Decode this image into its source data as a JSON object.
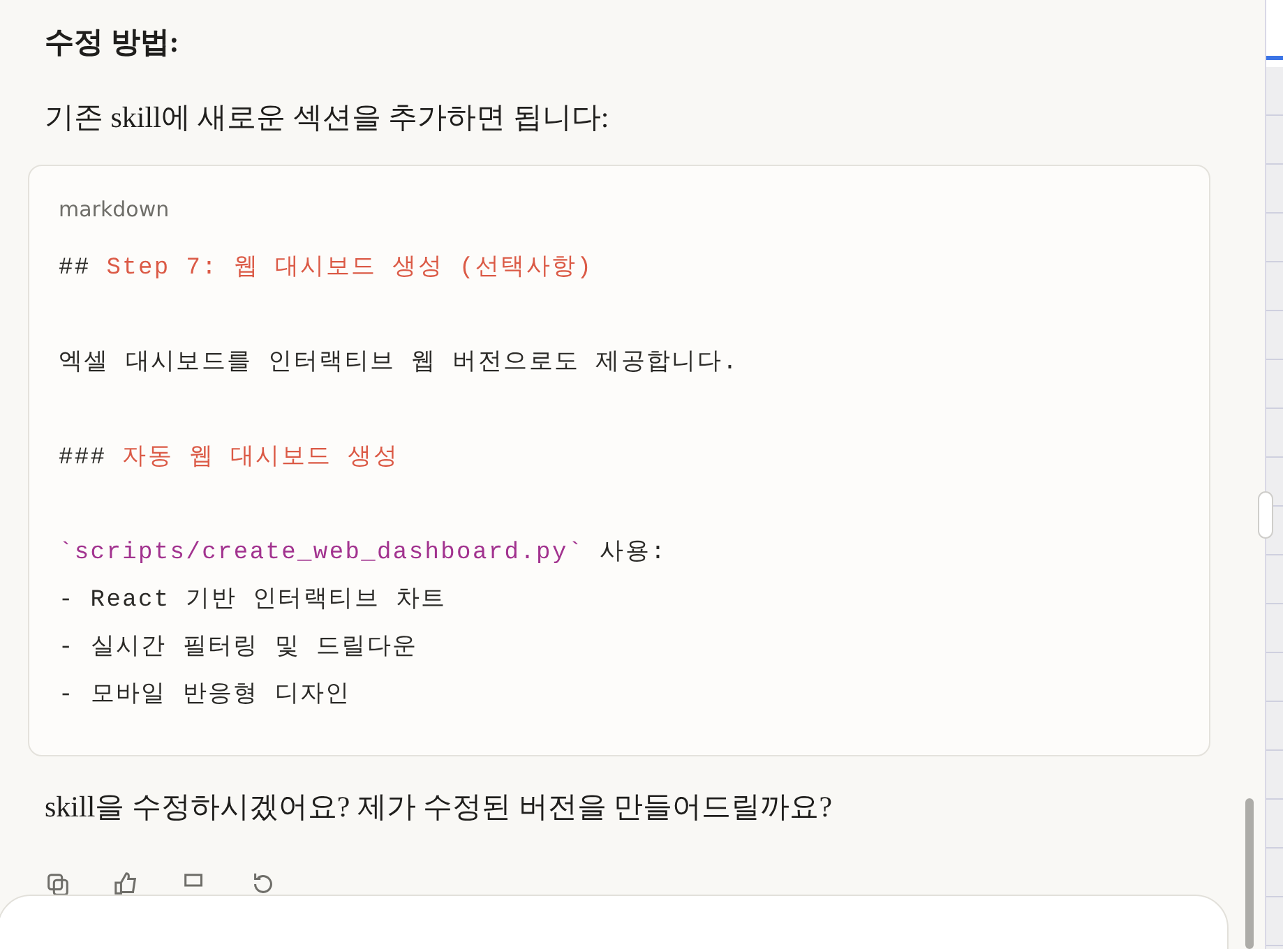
{
  "message": {
    "heading": "수정 방법:",
    "intro": "기존 skill에 새로운 섹션을 추가하면 됩니다:",
    "code": {
      "language": "markdown",
      "lines": [
        {
          "kind": "text",
          "segments": [
            {
              "kind": "plain",
              "text": "## "
            },
            {
              "kind": "heading",
              "text": "Step 7: 웹 대시보드 생성 (선택사항)"
            }
          ]
        },
        {
          "kind": "blank"
        },
        {
          "kind": "text",
          "segments": [
            {
              "kind": "plain",
              "text": "엑셀 대시보드를 인터랙티브 웹 버전으로도 제공합니다."
            }
          ]
        },
        {
          "kind": "blank"
        },
        {
          "kind": "text",
          "segments": [
            {
              "kind": "plain",
              "text": "### "
            },
            {
              "kind": "heading",
              "text": "자동 웹 대시보드 생성"
            }
          ]
        },
        {
          "kind": "blank"
        },
        {
          "kind": "text",
          "segments": [
            {
              "kind": "code",
              "text": "`scripts/create_web_dashboard.py`"
            },
            {
              "kind": "plain",
              "text": " 사용:"
            }
          ]
        },
        {
          "kind": "text",
          "segments": [
            {
              "kind": "plain",
              "text": "- React 기반 인터랙티브 차트"
            }
          ]
        },
        {
          "kind": "text",
          "segments": [
            {
              "kind": "plain",
              "text": "- 실시간 필터링 및 드릴다운"
            }
          ]
        },
        {
          "kind": "text",
          "segments": [
            {
              "kind": "plain",
              "text": "- 모바일 반응형 디자인"
            }
          ]
        }
      ]
    },
    "closing": "skill을 수정하시겠어요? 제가 수정된 버전을 만들어드릴까요?"
  }
}
